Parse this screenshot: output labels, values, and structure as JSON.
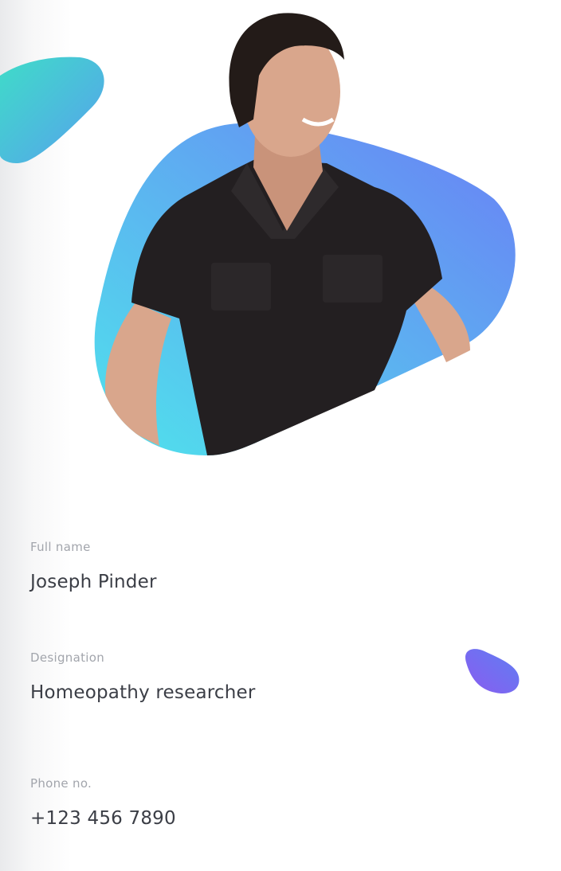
{
  "profile": {
    "photo_alt": "Profile photo",
    "fields": [
      {
        "label": "Full name",
        "value": "Joseph Pinder"
      },
      {
        "label": "Designation",
        "value": "Homeopathy researcher"
      },
      {
        "label": "Phone no.",
        "value": "+123 456 7890"
      }
    ]
  },
  "colors": {
    "blob_start": "#4fe3ec",
    "blob_end": "#6a8cf5",
    "small_blob_start": "#3fdcc8",
    "small_blob_end": "#57a8ee",
    "purple_blob": "#7a66f0",
    "label": "#a2a5ac",
    "value": "#3b3e46"
  }
}
